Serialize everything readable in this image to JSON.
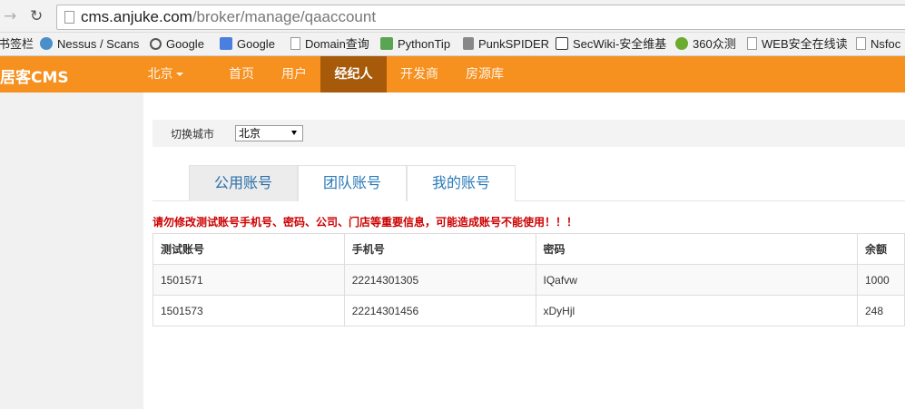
{
  "browser": {
    "url_host": "cms.anjuke.com",
    "url_path": "/broker/manage/qaaccount",
    "bookmarks": [
      "书签栏",
      "Nessus / Scans",
      "Google",
      "Google",
      "Domain查询",
      "PythonTip",
      "PunkSPIDER",
      "SecWiki-安全维基",
      "360众测",
      "WEB安全在线读",
      "Nsfoc"
    ]
  },
  "navbar": {
    "brand": "居客CMS",
    "city": "北京",
    "items": [
      "首页",
      "用户",
      "经纪人",
      "开发商",
      "房源库"
    ],
    "active_index": 2,
    "color": "#f6901e",
    "active_color": "#a75a09"
  },
  "filter": {
    "label": "切换城市",
    "selected_city": "北京"
  },
  "tabs": [
    "公用账号",
    "团队账号",
    "我的账号"
  ],
  "warning": "请勿修改测试账号手机号、密码、公司、门店等重要信息，可能造成账号不能使用！！！",
  "table": {
    "headers": [
      "测试账号",
      "手机号",
      "密码",
      "余额"
    ],
    "rows": [
      [
        "1501571",
        "22214301305",
        "IQafvw",
        "1000"
      ],
      [
        "1501573",
        "22214301456",
        "xDyHjl",
        "248"
      ]
    ]
  }
}
